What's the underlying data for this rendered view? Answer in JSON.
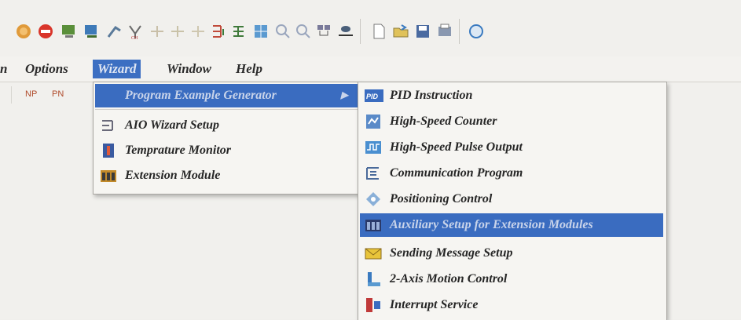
{
  "menubar": {
    "items": [
      "n",
      "Options",
      "Wizard",
      "Window",
      "Help"
    ],
    "active": "Wizard"
  },
  "subtoolbar": {
    "buttons": [
      "NP",
      "PN"
    ]
  },
  "wizard_menu": {
    "items": [
      {
        "label": "Program Example Generator",
        "icon": "wizard-icon",
        "has_submenu": true
      },
      {
        "label": "AIO Wizard Setup",
        "icon": "aio-icon"
      },
      {
        "label": "Temprature Monitor",
        "icon": "thermometer-icon"
      },
      {
        "label": "Extension Module",
        "icon": "module-icon"
      }
    ]
  },
  "program_example_menu": {
    "items": [
      {
        "label": "PID Instruction",
        "icon": "pid-icon"
      },
      {
        "label": "High-Speed Counter",
        "icon": "counter-icon"
      },
      {
        "label": "High-Speed Pulse Output",
        "icon": "pulse-icon"
      },
      {
        "label": "Communication Program",
        "icon": "communication-icon"
      },
      {
        "label": "Positioning Control",
        "icon": "positioning-icon"
      },
      {
        "label": "Auxiliary Setup for Extension Modules",
        "icon": "module-icon",
        "highlighted": true
      },
      {
        "label": "Sending Message Setup",
        "icon": "envelope-icon"
      },
      {
        "label": "2-Axis Motion Control",
        "icon": "motion-icon"
      },
      {
        "label": "Interrupt Service",
        "icon": "interrupt-icon"
      }
    ]
  },
  "colors": {
    "highlight": "#3a6cc0",
    "menu_bg": "#f6f5f2"
  }
}
